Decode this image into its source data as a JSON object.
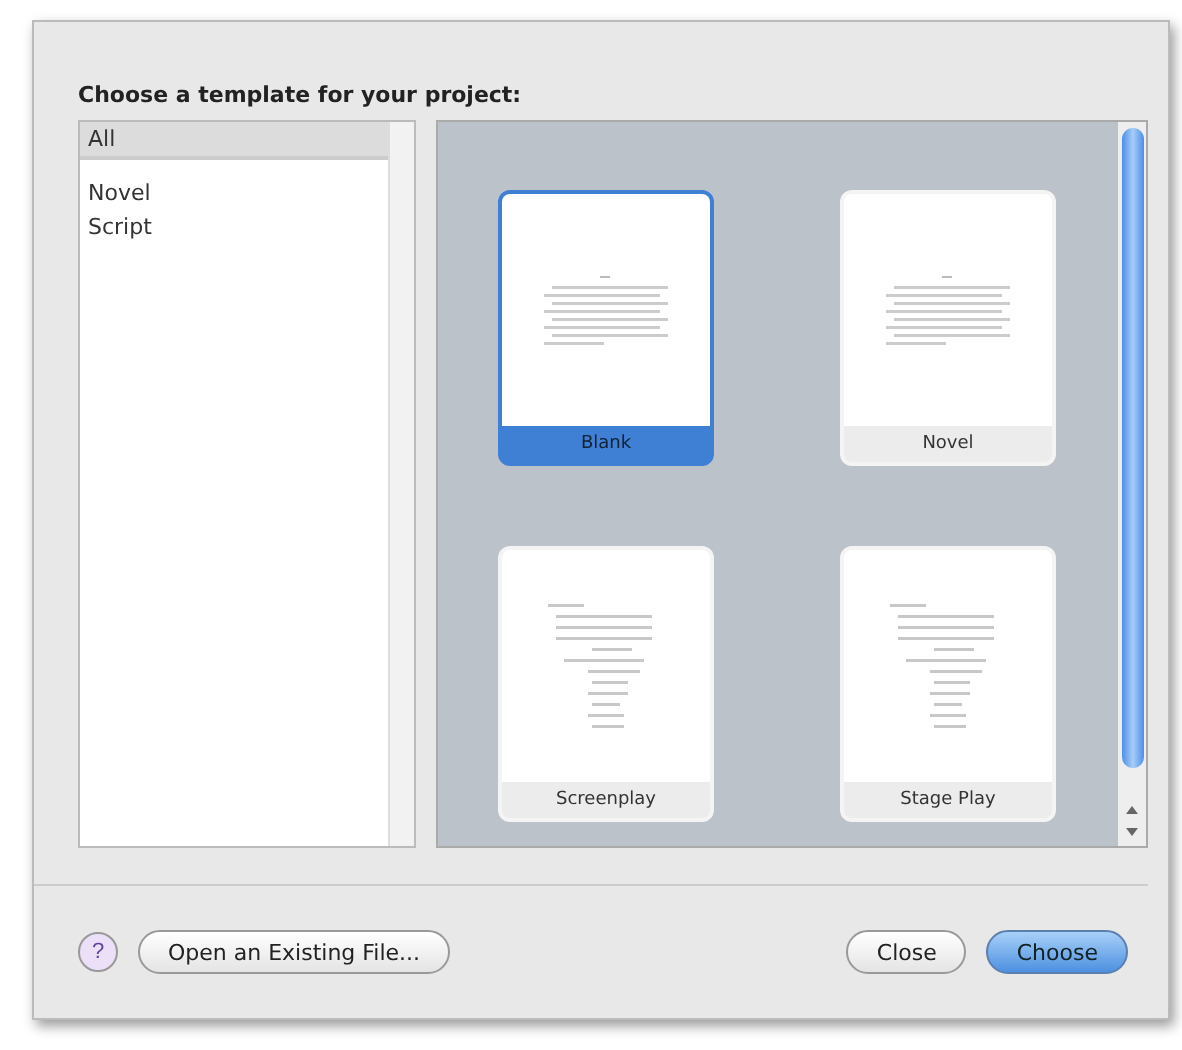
{
  "prompt": "Choose a template for your project:",
  "categories": [
    {
      "label": "All",
      "selected": true
    },
    {
      "label": "Novel",
      "selected": false
    },
    {
      "label": "Script",
      "selected": false
    }
  ],
  "templates": [
    {
      "label": "Blank",
      "kind": "prose",
      "selected": true
    },
    {
      "label": "Novel",
      "kind": "prose",
      "selected": false
    },
    {
      "label": "Screenplay",
      "kind": "script",
      "selected": false
    },
    {
      "label": "Stage Play",
      "kind": "script",
      "selected": false
    }
  ],
  "help": "?",
  "buttons": [
    {
      "label": "Open an Existing File...",
      "kind": "plain"
    },
    {
      "label": "Close",
      "kind": "plain"
    },
    {
      "label": "Choose",
      "kind": "default"
    }
  ]
}
